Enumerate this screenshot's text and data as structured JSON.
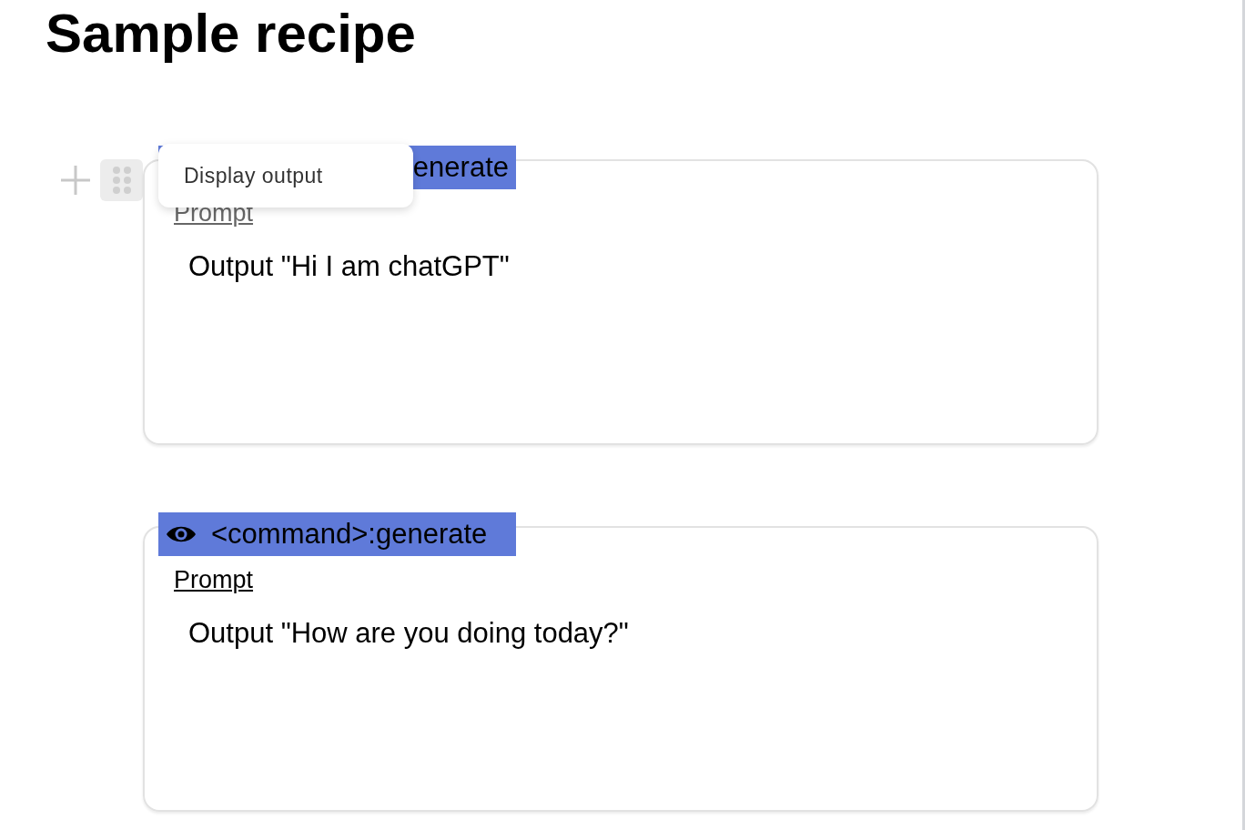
{
  "title": "Sample recipe",
  "menu": {
    "items": [
      "Display output"
    ]
  },
  "blocks": [
    {
      "header": "enerate",
      "prompt_label": "Prompt",
      "output": "Output \"Hi I am chatGPT\"",
      "hovered": true
    },
    {
      "header": "<command>:generate",
      "prompt_label": "Prompt",
      "output": "Output \"How are you doing today?\"",
      "hovered": false
    }
  ]
}
